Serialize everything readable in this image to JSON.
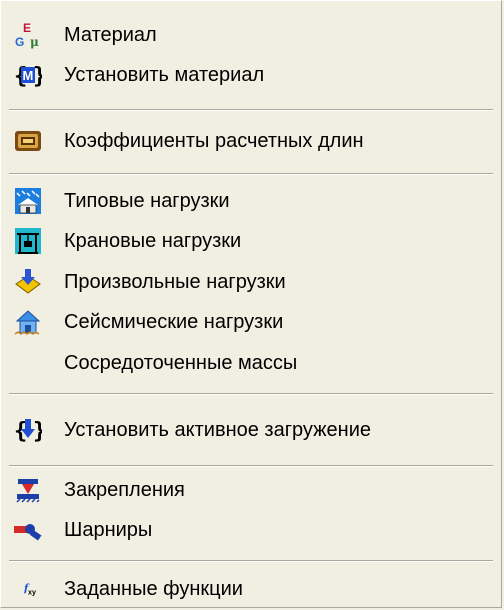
{
  "menu": {
    "items": [
      {
        "label": "Материал",
        "icon": "material-g-e-mu-icon"
      },
      {
        "label": "Установить материал",
        "icon": "set-material-brace-m-icon"
      },
      {
        "label": "Коэффициенты расчетных длин",
        "icon": "length-coefficients-icon"
      },
      {
        "label": "Типовые нагрузки",
        "icon": "typical-loads-icon"
      },
      {
        "label": "Крановые нагрузки",
        "icon": "crane-loads-icon"
      },
      {
        "label": "Произвольные нагрузки",
        "icon": "arbitrary-loads-icon"
      },
      {
        "label": "Сейсмические нагрузки",
        "icon": "seismic-loads-icon"
      },
      {
        "label": "Сосредоточенные массы",
        "icon": ""
      },
      {
        "label": "Установить активное загружение",
        "icon": "set-active-loading-icon"
      },
      {
        "label": "Закрепления",
        "icon": "supports-icon"
      },
      {
        "label": "Шарниры",
        "icon": "hinges-icon"
      },
      {
        "label": "Заданные функции",
        "icon": "given-functions-fxy-icon"
      }
    ]
  },
  "colors": {
    "background": "#f1efe2",
    "separator_dark": "#aca899",
    "separator_light": "#ffffff",
    "text": "#000000"
  }
}
